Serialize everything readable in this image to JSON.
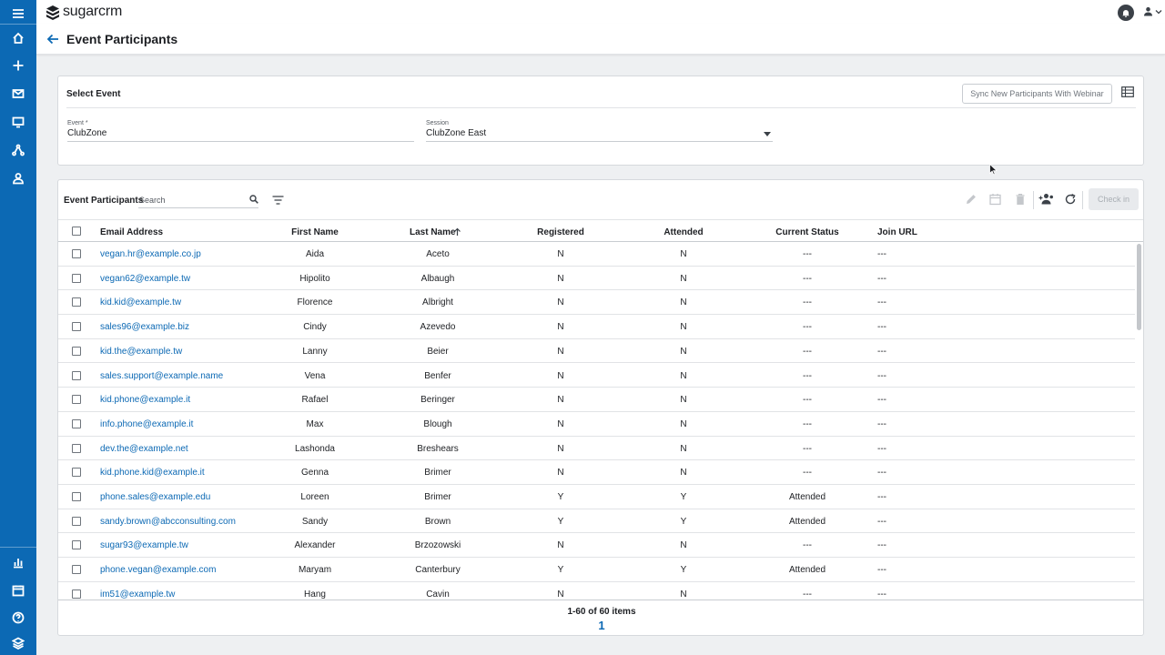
{
  "app": {
    "logo_text": "sugarcrm"
  },
  "leftnav": {
    "items": [
      {
        "name": "menu-icon"
      },
      {
        "name": "home-icon"
      },
      {
        "name": "plus-icon"
      },
      {
        "name": "mail-icon"
      },
      {
        "name": "monitor-icon"
      },
      {
        "name": "network-icon"
      },
      {
        "name": "contact-icon"
      },
      {
        "name": "chart-icon"
      },
      {
        "name": "calendar-icon"
      },
      {
        "name": "help-icon"
      },
      {
        "name": "layers-icon"
      }
    ]
  },
  "header": {
    "title": "Event Participants"
  },
  "select_event": {
    "title": "Select Event",
    "sync_label": "Sync New Participants With Webinar",
    "event_label": "Event *",
    "event_value": "ClubZone",
    "session_label": "Session",
    "session_value": "ClubZone East"
  },
  "list": {
    "title": "Event Participants",
    "search_placeholder": "Search",
    "checkin_label": "Check in",
    "columns": [
      "Email Address",
      "First Name",
      "Last Name",
      "Registered",
      "Attended",
      "Current Status",
      "Join URL"
    ],
    "sort_column": "Last Name",
    "rows": [
      {
        "email": "vegan.hr@example.co.jp",
        "first": "Aida",
        "last": "Aceto",
        "registered": "N",
        "attended": "N",
        "status": "---",
        "join_url": "---"
      },
      {
        "email": "vegan62@example.tw",
        "first": "Hipolito",
        "last": "Albaugh",
        "registered": "N",
        "attended": "N",
        "status": "---",
        "join_url": "---"
      },
      {
        "email": "kid.kid@example.tw",
        "first": "Florence",
        "last": "Albright",
        "registered": "N",
        "attended": "N",
        "status": "---",
        "join_url": "---"
      },
      {
        "email": "sales96@example.biz",
        "first": "Cindy",
        "last": "Azevedo",
        "registered": "N",
        "attended": "N",
        "status": "---",
        "join_url": "---"
      },
      {
        "email": "kid.the@example.tw",
        "first": "Lanny",
        "last": "Beier",
        "registered": "N",
        "attended": "N",
        "status": "---",
        "join_url": "---"
      },
      {
        "email": "sales.support@example.name",
        "first": "Vena",
        "last": "Benfer",
        "registered": "N",
        "attended": "N",
        "status": "---",
        "join_url": "---"
      },
      {
        "email": "kid.phone@example.it",
        "first": "Rafael",
        "last": "Beringer",
        "registered": "N",
        "attended": "N",
        "status": "---",
        "join_url": "---"
      },
      {
        "email": "info.phone@example.it",
        "first": "Max",
        "last": "Blough",
        "registered": "N",
        "attended": "N",
        "status": "---",
        "join_url": "---"
      },
      {
        "email": "dev.the@example.net",
        "first": "Lashonda",
        "last": "Breshears",
        "registered": "N",
        "attended": "N",
        "status": "---",
        "join_url": "---"
      },
      {
        "email": "kid.phone.kid@example.it",
        "first": "Genna",
        "last": "Brimer",
        "registered": "N",
        "attended": "N",
        "status": "---",
        "join_url": "---"
      },
      {
        "email": "phone.sales@example.edu",
        "first": "Loreen",
        "last": "Brimer",
        "registered": "Y",
        "attended": "Y",
        "status": "Attended",
        "join_url": "---"
      },
      {
        "email": "sandy.brown@abcconsulting.com",
        "first": "Sandy",
        "last": "Brown",
        "registered": "Y",
        "attended": "Y",
        "status": "Attended",
        "join_url": "---"
      },
      {
        "email": "sugar93@example.tw",
        "first": "Alexander",
        "last": "Brzozowski",
        "registered": "N",
        "attended": "N",
        "status": "---",
        "join_url": "---"
      },
      {
        "email": "phone.vegan@example.com",
        "first": "Maryam",
        "last": "Canterbury",
        "registered": "Y",
        "attended": "Y",
        "status": "Attended",
        "join_url": "---"
      },
      {
        "email": "im51@example.tw",
        "first": "Hang",
        "last": "Cavin",
        "registered": "N",
        "attended": "N",
        "status": "---",
        "join_url": "---"
      }
    ],
    "count_text": "1-60 of 60 items",
    "page": "1"
  },
  "colors": {
    "nav": "#0c69b4",
    "link": "#0c69b4"
  }
}
